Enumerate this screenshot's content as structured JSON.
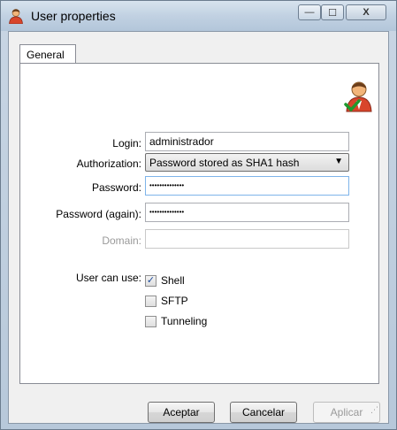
{
  "window": {
    "title": "User properties",
    "icon": "user-icon",
    "controls": {
      "minimize": "—",
      "maximize": "☐",
      "close": "X"
    }
  },
  "tabs": [
    {
      "label": "General",
      "selected": true
    }
  ],
  "form": {
    "login": {
      "label": "Login:",
      "value": "administrador"
    },
    "authorization": {
      "label": "Authorization:",
      "value": "Password stored as SHA1 hash"
    },
    "password": {
      "label": "Password:",
      "value": "••••••••••••••"
    },
    "password_again": {
      "label": "Password (again):",
      "value": "••••••••••••••"
    },
    "domain": {
      "label": "Domain:",
      "value": "",
      "enabled": false
    },
    "user_can_use": {
      "label": "User can use:",
      "options": [
        {
          "label": "Shell",
          "checked": true
        },
        {
          "label": "SFTP",
          "checked": false
        },
        {
          "label": "Tunneling",
          "checked": false
        }
      ]
    }
  },
  "buttons": {
    "accept": "Aceptar",
    "cancel": "Cancelar",
    "apply": "Aplicar"
  },
  "colors": {
    "frame": "#b7c8da",
    "panel": "#ffffff",
    "focus_border": "#7eb4ea",
    "disabled_text": "#9a9a9a"
  }
}
